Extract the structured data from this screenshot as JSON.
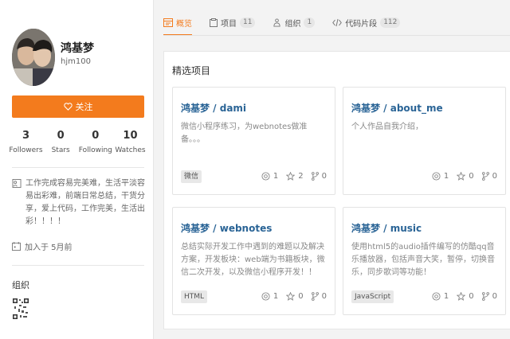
{
  "profile": {
    "name": "鸿基梦",
    "login": "hjm100",
    "follow_label": "关注",
    "stats": [
      {
        "value": "3",
        "label": "Followers"
      },
      {
        "value": "0",
        "label": "Stars"
      },
      {
        "value": "0",
        "label": "Following"
      },
      {
        "value": "10",
        "label": "Watches"
      }
    ],
    "bio": "工作完成容易完美难，生活平淡容易出彩难，前端日常总结，干货分享，爱上代码，工作完美，生活出彩！！！！",
    "joined": "加入于 5月前",
    "org_title": "组织"
  },
  "tabs": [
    {
      "label": "概览",
      "icon": "overview-icon",
      "count": null
    },
    {
      "label": "项目",
      "icon": "project-icon",
      "count": "11"
    },
    {
      "label": "组织",
      "icon": "organization-icon",
      "count": "1"
    },
    {
      "label": "代码片段",
      "icon": "snippet-icon",
      "count": "112"
    }
  ],
  "featured": {
    "title": "精选项目",
    "projects": [
      {
        "title": "鸿基梦 / dami",
        "desc": "微信小程序练习，为webnotes做准备。。。",
        "tag": "微信",
        "watches": "1",
        "stars": "2",
        "forks": "0"
      },
      {
        "title": "鸿基梦 / about_me",
        "desc": "个人作品自我介绍，",
        "tag": "",
        "watches": "1",
        "stars": "0",
        "forks": "0"
      },
      {
        "title": "鸿基梦 / webnotes",
        "desc": "总结实际开发工作中遇到的难题以及解决方案，开发板块：web端为书籍板块，微信二次开发，以及微信小程序开发！！",
        "tag": "HTML",
        "watches": "1",
        "stars": "0",
        "forks": "0"
      },
      {
        "title": "鸿基梦 / music",
        "desc": "使用html5的audio插件编写的仿酷qq音乐播放器，包括声音大笑，暂停，切换音乐，同步歌词等功能！",
        "tag": "JavaScript",
        "watches": "1",
        "stars": "0",
        "forks": "0"
      }
    ]
  },
  "colors": {
    "accent": "#f37b1d",
    "link": "#2a6496"
  }
}
